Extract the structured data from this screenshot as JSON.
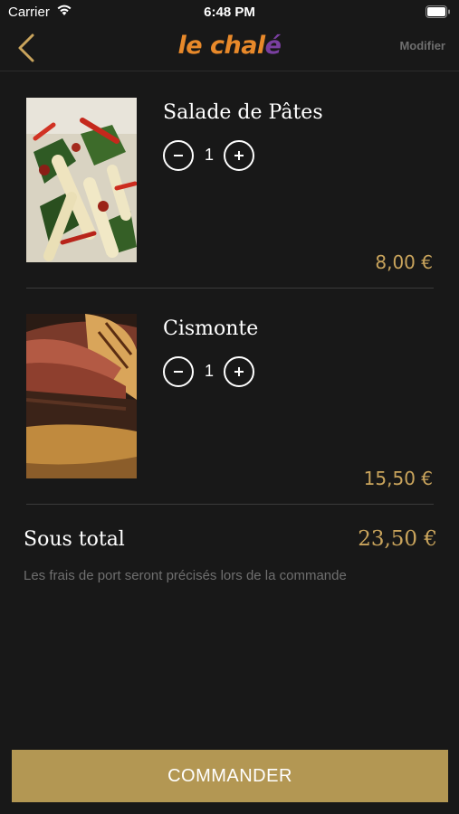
{
  "status_bar": {
    "carrier": "Carrier",
    "time": "6:48 PM"
  },
  "nav": {
    "logo_part1": "le ",
    "logo_part2": "chalé",
    "modify_label": "Modifier",
    "colors": {
      "logo_orange": "#e8892a",
      "logo_purple": "#7a3fa0",
      "accent_gold": "#c9a45c"
    }
  },
  "cart": {
    "items": [
      {
        "name": "Salade de Pâtes",
        "quantity": "1",
        "price": "8,00 €",
        "image": "pasta-salad-photo"
      },
      {
        "name": "Cismonte",
        "quantity": "1",
        "price": "15,50 €",
        "image": "burger-photo"
      }
    ],
    "subtotal_label": "Sous total",
    "subtotal_value": "23,50 €",
    "shipping_note": "Les frais de port seront précisés lors de la commande"
  },
  "order_button": {
    "label": "COMMANDER",
    "color": "#b39753"
  }
}
